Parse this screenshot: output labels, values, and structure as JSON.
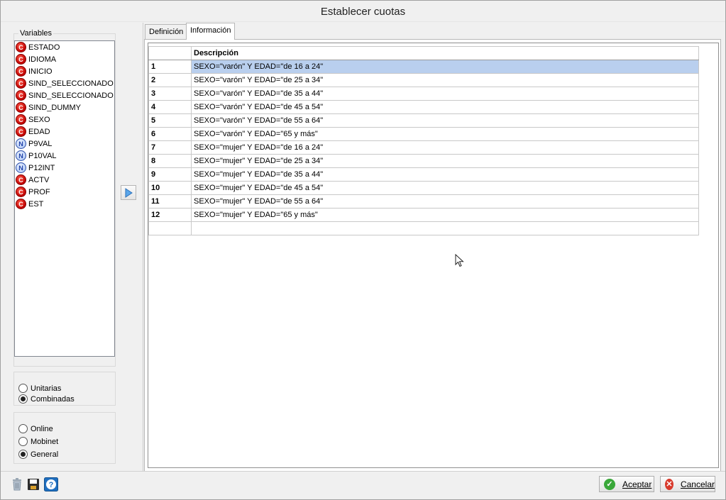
{
  "window": {
    "title": "Establecer cuotas"
  },
  "variables": {
    "group_label": "Variables",
    "items": [
      {
        "label": "ESTADO",
        "type": "C"
      },
      {
        "label": "IDIOMA",
        "type": "C"
      },
      {
        "label": "INICIO",
        "type": "C"
      },
      {
        "label": "SIND_SELECCIONADO",
        "type": "C"
      },
      {
        "label": "SIND_SELECCIONADO",
        "type": "C"
      },
      {
        "label": "SIND_DUMMY",
        "type": "C"
      },
      {
        "label": "SEXO",
        "type": "C"
      },
      {
        "label": "EDAD",
        "type": "C"
      },
      {
        "label": "P9VAL",
        "type": "N"
      },
      {
        "label": "P10VAL",
        "type": "N"
      },
      {
        "label": "P12INT",
        "type": "N"
      },
      {
        "label": "ACTV",
        "type": "C"
      },
      {
        "label": "PROF",
        "type": "C"
      },
      {
        "label": "EST",
        "type": "C"
      }
    ]
  },
  "mode_options": [
    {
      "label": "Unitarias",
      "selected": false
    },
    {
      "label": "Combinadas",
      "selected": true
    }
  ],
  "channel_options": [
    {
      "label": "Online",
      "selected": false
    },
    {
      "label": "Mobinet",
      "selected": false
    },
    {
      "label": "General",
      "selected": true
    }
  ],
  "tabs": [
    {
      "label": "Definición",
      "active": false
    },
    {
      "label": "Información",
      "active": true
    }
  ],
  "grid": {
    "header": "Descripción",
    "rows": [
      {
        "n": "1",
        "desc": "SEXO=\"varón\" Y EDAD=\"de 16 a 24\""
      },
      {
        "n": "2",
        "desc": "SEXO=\"varón\" Y EDAD=\"de 25 a 34\""
      },
      {
        "n": "3",
        "desc": "SEXO=\"varón\" Y EDAD=\"de 35 a 44\""
      },
      {
        "n": "4",
        "desc": "SEXO=\"varón\" Y EDAD=\"de 45 a 54\""
      },
      {
        "n": "5",
        "desc": "SEXO=\"varón\" Y EDAD=\"de 55 a 64\""
      },
      {
        "n": "6",
        "desc": "SEXO=\"varón\" Y EDAD=\"65 y más\""
      },
      {
        "n": "7",
        "desc": "SEXO=\"mujer\" Y EDAD=\"de 16 a 24\""
      },
      {
        "n": "8",
        "desc": "SEXO=\"mujer\" Y EDAD=\"de 25 a 34\""
      },
      {
        "n": "9",
        "desc": "SEXO=\"mujer\" Y EDAD=\"de 35 a 44\""
      },
      {
        "n": "10",
        "desc": "SEXO=\"mujer\" Y EDAD=\"de 45 a 54\""
      },
      {
        "n": "11",
        "desc": "SEXO=\"mujer\" Y EDAD=\"de 55 a 64\""
      },
      {
        "n": "12",
        "desc": "SEXO=\"mujer\" Y EDAD=\"65 y más\""
      }
    ],
    "selected_row": 1
  },
  "buttons": {
    "accept_label": "Aceptar",
    "cancel_label": "Cancelar"
  },
  "icons": {
    "delete": "trash-icon",
    "save": "save-icon",
    "help": "help-icon",
    "add": "play-arrow-icon"
  },
  "colors": {
    "selected_row": "#b9cfee",
    "accept": "#3aa83a",
    "cancel": "#d83a2c",
    "help": "#1f6fc0"
  }
}
